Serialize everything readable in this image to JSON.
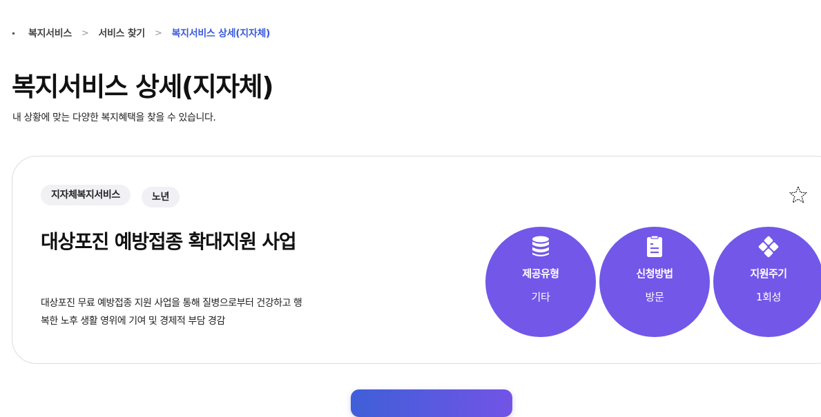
{
  "breadcrumb": {
    "items": [
      "복지서비스",
      "서비스 찾기",
      "복지서비스 상세(지자체)"
    ],
    "separator": ">"
  },
  "header": {
    "title": "복지서비스 상세(지자체)",
    "description": "내 상황에 맞는 다양한 복지혜택을 찾을 수 있습니다."
  },
  "service": {
    "tags": [
      "지자체복지서비스",
      "노년"
    ],
    "favorite_icon": "star-icon",
    "title": "대상포진 예방접종 확대지원 사업",
    "description": "대상포진 무료 예방접종 지원 사업을 통해 질병으로부터 건강하고 행복한 노후 생활 영위에 기여 및 경제적 부담 경감",
    "info": [
      {
        "icon": "database-icon",
        "label": "제공유형",
        "value": "기타"
      },
      {
        "icon": "clipboard-list-icon",
        "label": "신청방법",
        "value": "방문"
      },
      {
        "icon": "diamond-dots-icon",
        "label": "지원주기",
        "value": "1회성"
      }
    ]
  },
  "colors": {
    "accent": "#7357e8",
    "breadcrumb_current": "#3b5bdb",
    "button_gradient_start": "#3f5fd8",
    "button_gradient_end": "#7254e6"
  }
}
